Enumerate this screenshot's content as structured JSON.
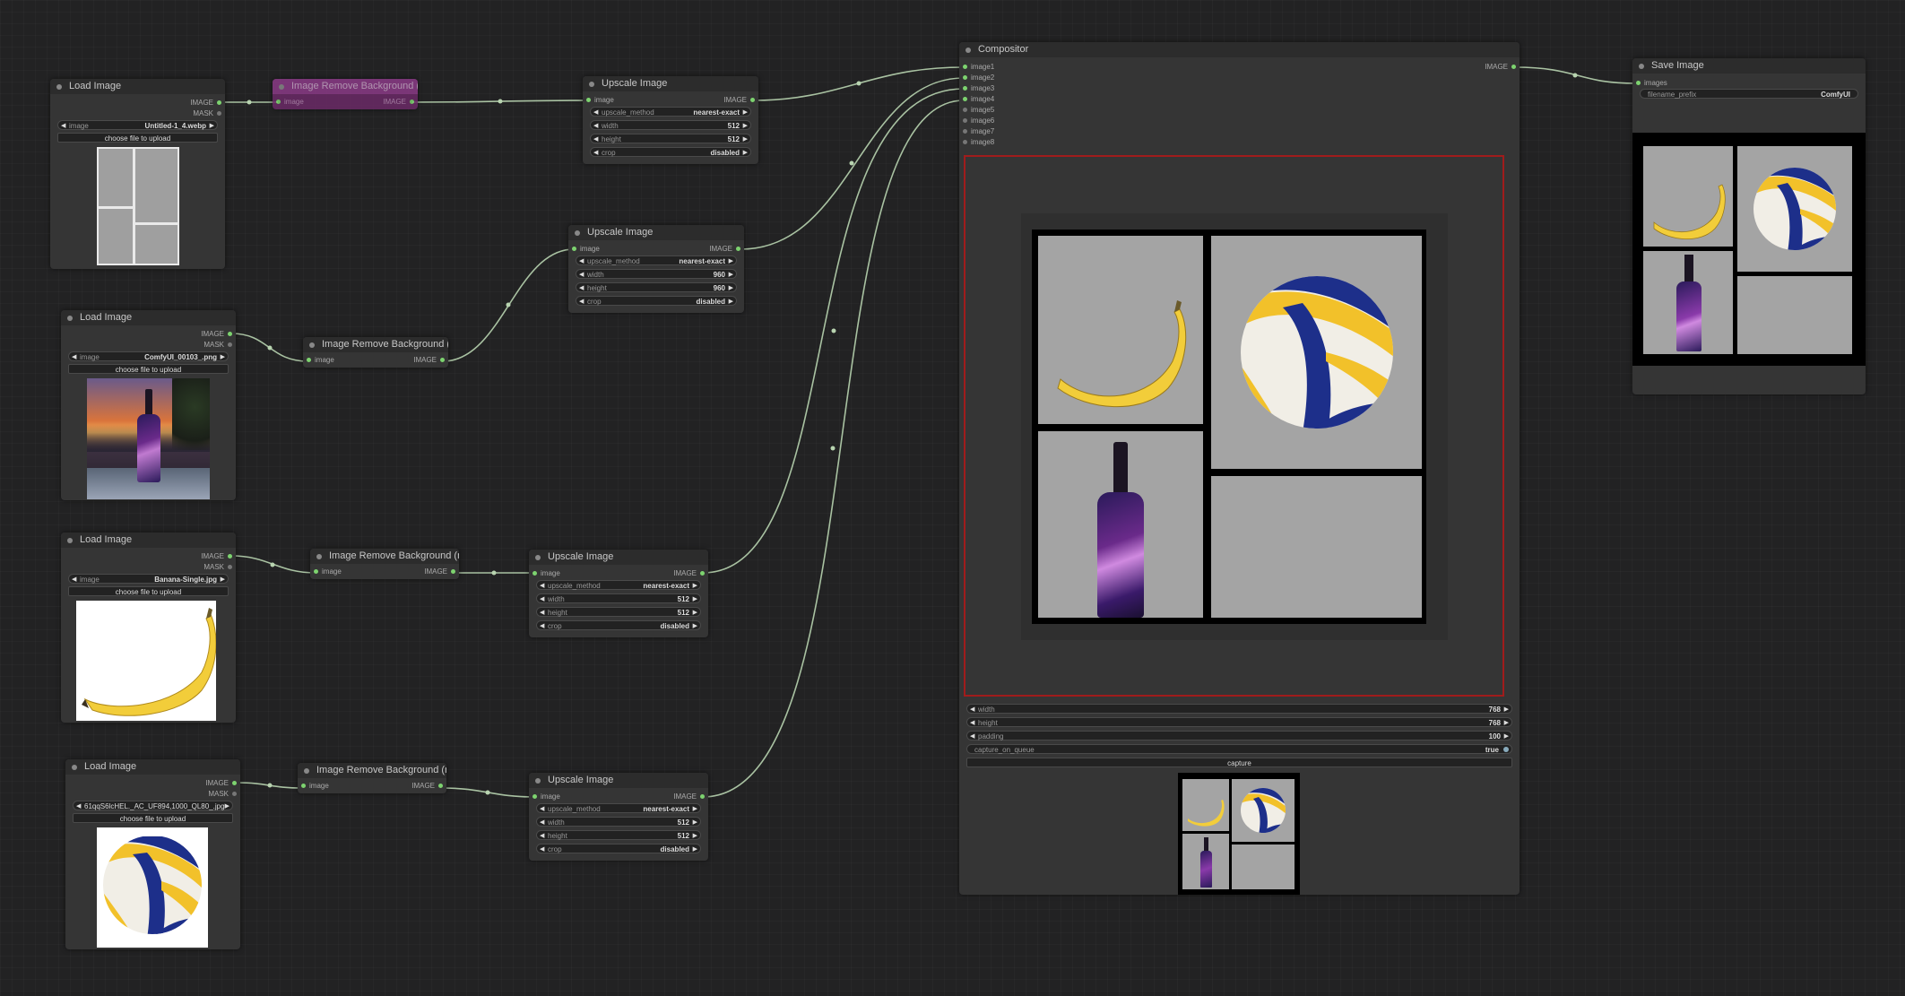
{
  "colors": {
    "background": "#222223",
    "node_body": "#353535",
    "node_title": "#2c2c2c",
    "link": "#b8d4b0",
    "slot_connected": "#7dd36f",
    "bypass": "#6a2a66",
    "canvas_border": "#a01c1c"
  },
  "nodes": {
    "load1": {
      "title": "Load Image",
      "out_image": "IMAGE",
      "out_mask": "MASK",
      "image_label": "image",
      "image_value": "Untitled-1_4.webp",
      "upload_label": "choose file to upload"
    },
    "load2": {
      "title": "Load Image",
      "out_image": "IMAGE",
      "out_mask": "MASK",
      "image_label": "image",
      "image_value": "ComfyUI_00103_.png",
      "upload_label": "choose file to upload"
    },
    "load3": {
      "title": "Load Image",
      "out_image": "IMAGE",
      "out_mask": "MASK",
      "image_label": "image",
      "image_value": "Banana-Single.jpg",
      "upload_label": "choose file to upload"
    },
    "load4": {
      "title": "Load Image",
      "out_image": "IMAGE",
      "out_mask": "MASK",
      "image_label": "image",
      "image_value": "61qqS6lcHEL._AC_UF894,1000_QL80_.jpg",
      "upload_label": "choose file to upload"
    },
    "rembg_bypass": {
      "title": "Image Remove Background (rembg)",
      "in_label": "image",
      "out_label": "IMAGE"
    },
    "rembg2": {
      "title": "Image Remove Background (rembg)",
      "in_label": "image",
      "out_label": "IMAGE"
    },
    "rembg3": {
      "title": "Image Remove Background (rembg)",
      "in_label": "image",
      "out_label": "IMAGE"
    },
    "rembg4": {
      "title": "Image Remove Background (rembg)",
      "in_label": "image",
      "out_label": "IMAGE"
    },
    "up1": {
      "title": "Upscale Image",
      "in_label": "image",
      "out_label": "IMAGE",
      "method_label": "upscale_method",
      "method": "nearest-exact",
      "width_label": "width",
      "width": "512",
      "height_label": "height",
      "height": "512",
      "crop_label": "crop",
      "crop": "disabled"
    },
    "up2": {
      "title": "Upscale Image",
      "in_label": "image",
      "out_label": "IMAGE",
      "method_label": "upscale_method",
      "method": "nearest-exact",
      "width_label": "width",
      "width": "960",
      "height_label": "height",
      "height": "960",
      "crop_label": "crop",
      "crop": "disabled"
    },
    "up3": {
      "title": "Upscale Image",
      "in_label": "image",
      "out_label": "IMAGE",
      "method_label": "upscale_method",
      "method": "nearest-exact",
      "width_label": "width",
      "width": "512",
      "height_label": "height",
      "height": "512",
      "crop_label": "crop",
      "crop": "disabled"
    },
    "up4": {
      "title": "Upscale Image",
      "in_label": "image",
      "out_label": "IMAGE",
      "method_label": "upscale_method",
      "method": "nearest-exact",
      "width_label": "width",
      "width": "512",
      "height_label": "height",
      "height": "512",
      "crop_label": "crop",
      "crop": "disabled"
    },
    "compositor": {
      "title": "Compositor",
      "inputs": [
        "image1",
        "image2",
        "image3",
        "image4",
        "image5",
        "image6",
        "image7",
        "image8"
      ],
      "out_label": "IMAGE",
      "width_label": "width",
      "width": "768",
      "height_label": "height",
      "height": "768",
      "padding_label": "padding",
      "padding": "100",
      "capture_label": "capture_on_queue",
      "capture_value": "true",
      "capture_button": "capture"
    },
    "save": {
      "title": "Save Image",
      "in_label": "images",
      "prefix_label": "filename_prefix",
      "prefix_value": "ComfyUI"
    }
  }
}
